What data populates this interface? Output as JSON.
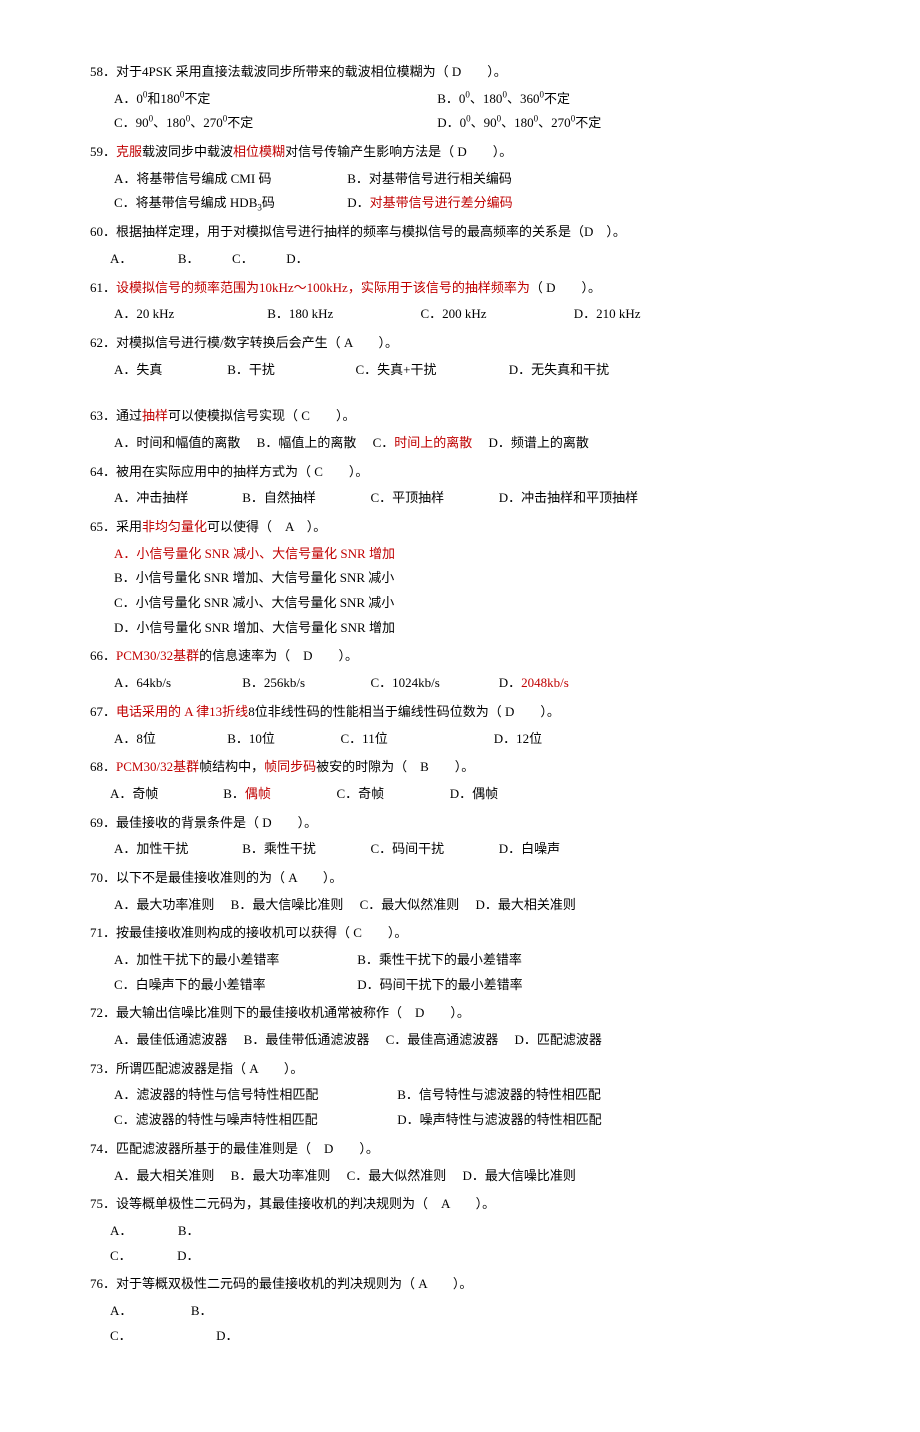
{
  "q58": {
    "text": "58．对于4PSK 采用直接法载波同步所带来的载波相位模糊为（ D　　）。",
    "a": "A．0⁰和180⁰不定",
    "b": "B．0⁰、180⁰、360⁰不定",
    "c": "C．90⁰、180⁰、270⁰不定",
    "d": "D．0⁰、90⁰、180⁰、270⁰不定"
  },
  "q59": {
    "p1": "59．",
    "r1": "克服",
    "p2": "载波同步中载波",
    "r2": "相位模糊",
    "p3": "对信号传输产生影响方法是（ D　　）。",
    "a": "A．将基带信号编成 CMI 码",
    "b": "B．对基带信号进行相关编码",
    "c": "C．将基带信号编成 HDB₃码",
    "d1": "D．",
    "d2": "对基带信号进行差分编码"
  },
  "q60": {
    "text": "60．根据抽样定理，用于对模拟信号进行抽样的频率与模拟信号的最高频率的关系是（D　）。",
    "opts": "A．　　　　B．　　　C．　　　D．"
  },
  "q61": {
    "p1": "61．",
    "r1": "设模拟信号的频率范围为10kHz～100kHz，实际用于该信号的抽样频率为",
    "p2": "（ D　　）。",
    "a": "A．20 kHz",
    "b": "B．180  kHz",
    "c": "C．200  kHz",
    "d": "D．210 kHz"
  },
  "q62": {
    "text": "62．对模拟信号进行模/数字转换后会产生（ A　　）。",
    "a": "A．失真",
    "b": "B．干扰",
    "c": "C．失真+干扰",
    "d": "D．无失真和干扰"
  },
  "q63": {
    "p1": "63．通过",
    "r1": "抽样",
    "p2": "可以使模拟信号实现（ C　　）。",
    "a": "A．时间和幅值的离散",
    "b": "B．幅值上的离散",
    "c1": "C．",
    "c2": "时间上的离散",
    "d": "D．频谱上的离散"
  },
  "q64": {
    "text": "64．被用在实际应用中的抽样方式为（ C　　）。",
    "a": "A．冲击抽样",
    "b": "B．自然抽样",
    "c": "C．平顶抽样",
    "d": "D．冲击抽样和平顶抽样"
  },
  "q65": {
    "p1": "65．采用",
    "r1": "非均匀量化",
    "p2": "可以使得（　A　）。",
    "a": "A．小信号量化 SNR 减小、大信号量化 SNR 增加",
    "b": "B．小信号量化 SNR 增加、大信号量化 SNR 减小",
    "c": "C．小信号量化 SNR 减小、大信号量化 SNR 减小",
    "d": "D．小信号量化 SNR 增加、大信号量化 SNR 增加"
  },
  "q66": {
    "p1": "66．",
    "r1": "PCM30/32基群",
    "p2": "的信息速率为（　D　　）。",
    "a": "A．64kb/s",
    "b": "B．256kb/s",
    "c": "C．1024kb/s",
    "d1": "D．",
    "d2": "2048kb/s"
  },
  "q67": {
    "p1": "67．",
    "r1": "电话采用的 A 律13折线",
    "p2": "8位非线性码的性能相当于编线性码位数为（ D　　）。",
    "a": "A．8位",
    "b": "B．10位",
    "c": "C．11位",
    "d": "D．12位"
  },
  "q68": {
    "p1": "68．",
    "r1": "PCM30/32基群",
    "p2": "帧结构中，",
    "r2": "帧同步码",
    "p3": "被安的时隙为（　B　　）。",
    "a": "A．奇帧",
    "b1": "B．",
    "b2": "偶帧",
    "c": "C．奇帧",
    "d": "D．偶帧"
  },
  "q69": {
    "text": "69．最佳接收的背景条件是（ D　　）。",
    "a": "A．加性干扰",
    "b": "B．乘性干扰",
    "c": "C．码间干扰",
    "d": "D．白噪声"
  },
  "q70": {
    "text": "70．以下不是最佳接收准则的为（ A　　）。",
    "a": "A．最大功率准则",
    "b": "B．最大信噪比准则",
    "c": "C．最大似然准则",
    "d": "D．最大相关准则"
  },
  "q71": {
    "text": "71．按最佳接收准则构成的接收机可以获得（ C　　）。",
    "a": "A．加性干扰下的最小差错率",
    "b": "B．乘性干扰下的最小差错率",
    "c": "C．白噪声下的最小差错率",
    "d": "D．码间干扰下的最小差错率"
  },
  "q72": {
    "text": "72．最大输出信噪比准则下的最佳接收机通常被称作（　D　　）。",
    "a": "A．最佳低通滤波器",
    "b": "B．最佳带低通滤波器",
    "c": "C．最佳高通滤波器",
    "d": "D．匹配滤波器"
  },
  "q73": {
    "text": "73．所谓匹配滤波器是指（ A　　）。",
    "a": "A．滤波器的特性与信号特性相匹配",
    "b": "B．信号特性与滤波器的特性相匹配",
    "c": "C．滤波器的特性与噪声特性相匹配",
    "d": "D．噪声特性与滤波器的特性相匹配"
  },
  "q74": {
    "text": "74．匹配滤波器所基于的最佳准则是（　D　　）。",
    "a": "A．最大相关准则",
    "b": "B．最大功率准则",
    "c": "C．最大似然准则",
    "d": "D．最大信噪比准则"
  },
  "q75": {
    "text": "75．设等概单极性二元码为，其最佳接收机的判决规则为（　A　　）。",
    "opts1": "A．　　　　B．",
    "opts2": "C．　　　　D．"
  },
  "q76": {
    "text": "76．对于等概双极性二元码的最佳接收机的判决规则为（ A　　）。",
    "opts1": "A．　　　　　B．",
    "opts2": "C．　　　　　　　D．"
  }
}
